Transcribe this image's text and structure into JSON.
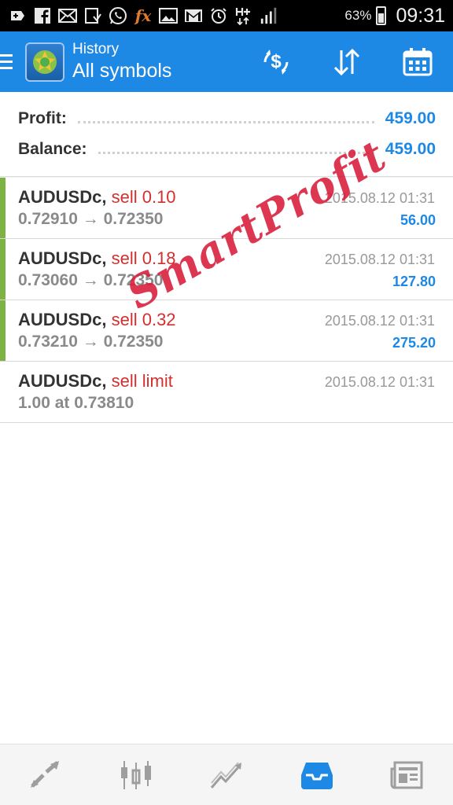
{
  "status_bar": {
    "icons": [
      "plus-box-icon",
      "facebook-icon",
      "mail-icon",
      "download-icon",
      "whatsapp-icon",
      "fx-icon",
      "image-icon",
      "gmail-icon",
      "alarm-icon",
      "hplus-icon",
      "signal-icon"
    ],
    "fx_label": "fx",
    "battery": "63%",
    "time": "09:31"
  },
  "app_bar": {
    "title": "History",
    "subtitle": "All symbols"
  },
  "summary": {
    "profit_label": "Profit:",
    "profit_value": "459.00",
    "balance_label": "Balance:",
    "balance_value": "459.00"
  },
  "deals": [
    {
      "symbol": "AUDUSDc,",
      "action": "sell 0.10",
      "prices": "0.72910 → 0.72350",
      "time": "2015.08.12 01:31",
      "profit": "56.00"
    },
    {
      "symbol": "AUDUSDc,",
      "action": "sell 0.18",
      "prices": "0.73060 → 0.72350",
      "time": "2015.08.12 01:31",
      "profit": "127.80"
    },
    {
      "symbol": "AUDUSDc,",
      "action": "sell 0.32",
      "prices": "0.73210 → 0.72350",
      "time": "2015.08.12 01:31",
      "profit": "275.20"
    },
    {
      "symbol": "AUDUSDc,",
      "action": "sell limit",
      "prices": "1.00 at 0.73810",
      "time": "2015.08.12 01:31",
      "profit": ""
    }
  ],
  "watermark": "SmartProfit",
  "colors": {
    "accent": "#1e88e5",
    "sell": "#d32f2f",
    "profit_bar": "#7cb342",
    "watermark": "#d81b3a"
  },
  "bottom_nav": [
    "quotes-icon",
    "chart-icon",
    "trade-icon",
    "history-icon",
    "news-icon"
  ]
}
